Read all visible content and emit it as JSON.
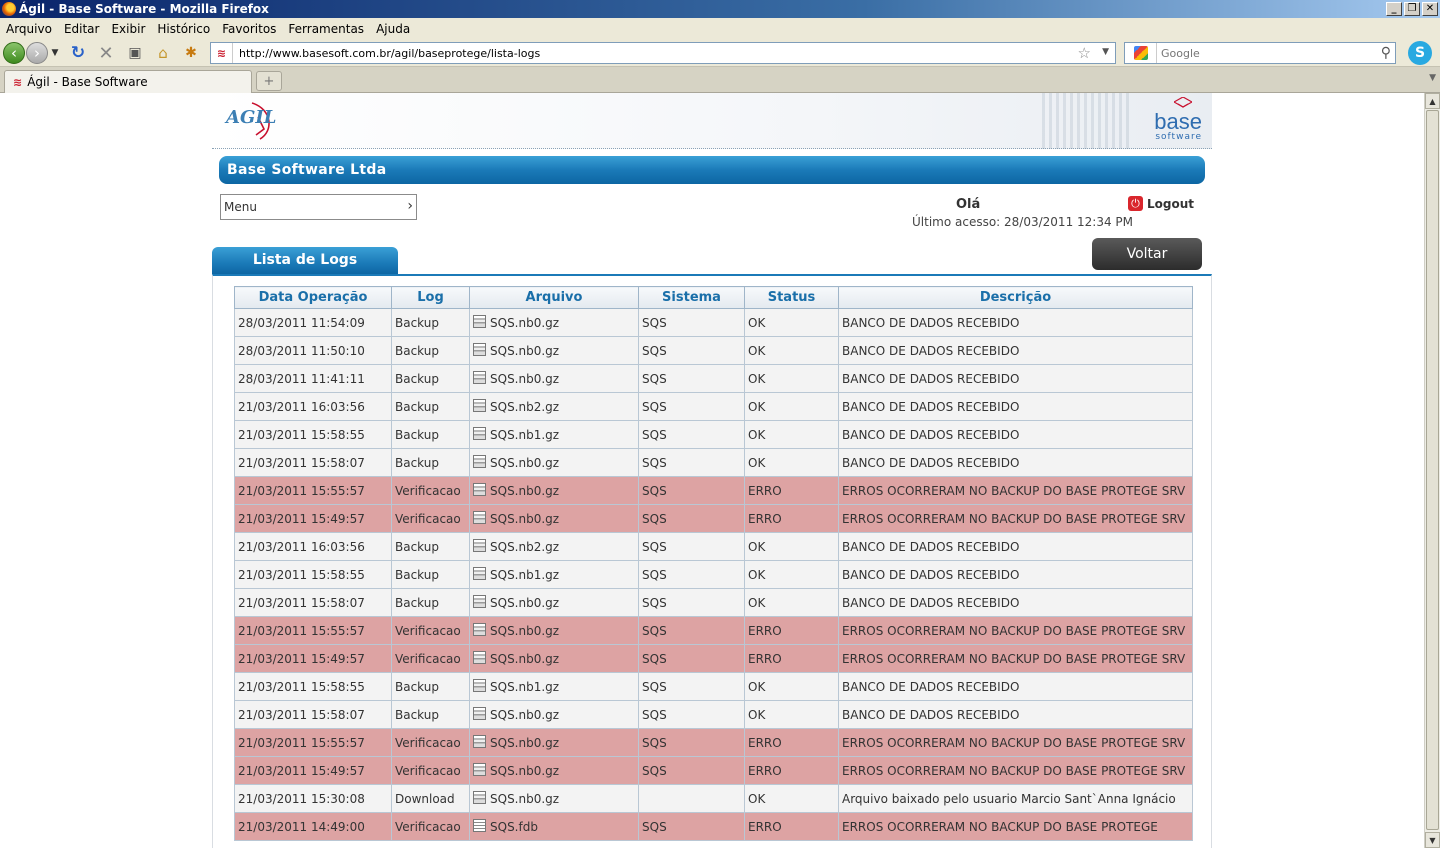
{
  "window": {
    "title": "Ágil - Base Software - Mozilla Firefox"
  },
  "menubar": [
    "Arquivo",
    "Editar",
    "Exibir",
    "Histórico",
    "Favoritos",
    "Ferramentas",
    "Ajuda"
  ],
  "navbar": {
    "url": "http://www.basesoft.com.br/agil/baseprotege/lista-logs",
    "search_placeholder": "Google"
  },
  "tab": {
    "title": "Ágil - Base Software"
  },
  "site": {
    "logo_text": "AGIL",
    "brand_word": "base",
    "brand_sub": "software",
    "company": "Base Software Ltda",
    "menu_label": "Menu",
    "greeting": "Olá",
    "last_access": "Último acesso: 28/03/2011  12:34 PM",
    "logout": "Logout",
    "section_title": "Lista de Logs",
    "back_button": "Voltar"
  },
  "table": {
    "headers": [
      "Data Operação",
      "Log",
      "Arquivo",
      "Sistema",
      "Status",
      "Descrição"
    ],
    "rows": [
      {
        "date": "28/03/2011 11:54:09",
        "log": "Backup",
        "file": "SQS.nb0.gz",
        "system": "SQS",
        "status": "OK",
        "desc": "BANCO DE DADOS RECEBIDO",
        "error": false
      },
      {
        "date": "28/03/2011 11:50:10",
        "log": "Backup",
        "file": "SQS.nb0.gz",
        "system": "SQS",
        "status": "OK",
        "desc": "BANCO DE DADOS RECEBIDO",
        "error": false
      },
      {
        "date": "28/03/2011 11:41:11",
        "log": "Backup",
        "file": "SQS.nb0.gz",
        "system": "SQS",
        "status": "OK",
        "desc": "BANCO DE DADOS RECEBIDO",
        "error": false
      },
      {
        "date": "21/03/2011 16:03:56",
        "log": "Backup",
        "file": "SQS.nb2.gz",
        "system": "SQS",
        "status": "OK",
        "desc": "BANCO DE DADOS RECEBIDO",
        "error": false
      },
      {
        "date": "21/03/2011 15:58:55",
        "log": "Backup",
        "file": "SQS.nb1.gz",
        "system": "SQS",
        "status": "OK",
        "desc": "BANCO DE DADOS RECEBIDO",
        "error": false
      },
      {
        "date": "21/03/2011 15:58:07",
        "log": "Backup",
        "file": "SQS.nb0.gz",
        "system": "SQS",
        "status": "OK",
        "desc": "BANCO DE DADOS RECEBIDO",
        "error": false
      },
      {
        "date": "21/03/2011 15:55:57",
        "log": "Verificacao",
        "file": "SQS.nb0.gz",
        "system": "SQS",
        "status": "ERRO",
        "desc": "ERROS OCORRERAM NO BACKUP DO BASE PROTEGE SRV",
        "error": true
      },
      {
        "date": "21/03/2011 15:49:57",
        "log": "Verificacao",
        "file": "SQS.nb0.gz",
        "system": "SQS",
        "status": "ERRO",
        "desc": "ERROS OCORRERAM NO BACKUP DO BASE PROTEGE SRV",
        "error": true
      },
      {
        "date": "21/03/2011 16:03:56",
        "log": "Backup",
        "file": "SQS.nb2.gz",
        "system": "SQS",
        "status": "OK",
        "desc": "BANCO DE DADOS RECEBIDO",
        "error": false
      },
      {
        "date": "21/03/2011 15:58:55",
        "log": "Backup",
        "file": "SQS.nb1.gz",
        "system": "SQS",
        "status": "OK",
        "desc": "BANCO DE DADOS RECEBIDO",
        "error": false
      },
      {
        "date": "21/03/2011 15:58:07",
        "log": "Backup",
        "file": "SQS.nb0.gz",
        "system": "SQS",
        "status": "OK",
        "desc": "BANCO DE DADOS RECEBIDO",
        "error": false
      },
      {
        "date": "21/03/2011 15:55:57",
        "log": "Verificacao",
        "file": "SQS.nb0.gz",
        "system": "SQS",
        "status": "ERRO",
        "desc": "ERROS OCORRERAM NO BACKUP DO BASE PROTEGE SRV",
        "error": true
      },
      {
        "date": "21/03/2011 15:49:57",
        "log": "Verificacao",
        "file": "SQS.nb0.gz",
        "system": "SQS",
        "status": "ERRO",
        "desc": "ERROS OCORRERAM NO BACKUP DO BASE PROTEGE SRV",
        "error": true
      },
      {
        "date": "21/03/2011 15:58:55",
        "log": "Backup",
        "file": "SQS.nb1.gz",
        "system": "SQS",
        "status": "OK",
        "desc": "BANCO DE DADOS RECEBIDO",
        "error": false
      },
      {
        "date": "21/03/2011 15:58:07",
        "log": "Backup",
        "file": "SQS.nb0.gz",
        "system": "SQS",
        "status": "OK",
        "desc": "BANCO DE DADOS RECEBIDO",
        "error": false
      },
      {
        "date": "21/03/2011 15:55:57",
        "log": "Verificacao",
        "file": "SQS.nb0.gz",
        "system": "SQS",
        "status": "ERRO",
        "desc": "ERROS OCORRERAM NO BACKUP DO BASE PROTEGE SRV",
        "error": true
      },
      {
        "date": "21/03/2011 15:49:57",
        "log": "Verificacao",
        "file": "SQS.nb0.gz",
        "system": "SQS",
        "status": "ERRO",
        "desc": "ERROS OCORRERAM NO BACKUP DO BASE PROTEGE SRV",
        "error": true
      },
      {
        "date": "21/03/2011 15:30:08",
        "log": "Download",
        "file": "SQS.nb0.gz",
        "system": "",
        "status": "OK",
        "desc": "Arquivo baixado pelo usuario Marcio Sant`Anna Ignácio",
        "error": false
      },
      {
        "date": "21/03/2011 14:49:00",
        "log": "Verificacao",
        "file": "SQS.fdb",
        "system": "SQS",
        "status": "ERRO",
        "desc": "ERROS OCORRERAM NO BACKUP DO BASE PROTEGE",
        "error": true,
        "fdb": true
      }
    ]
  },
  "colors": {
    "accent": "#1b7ab8",
    "error_row": "#dda3a3",
    "normal_row": "#f3f3f3",
    "header_text": "#1a6fa9"
  }
}
